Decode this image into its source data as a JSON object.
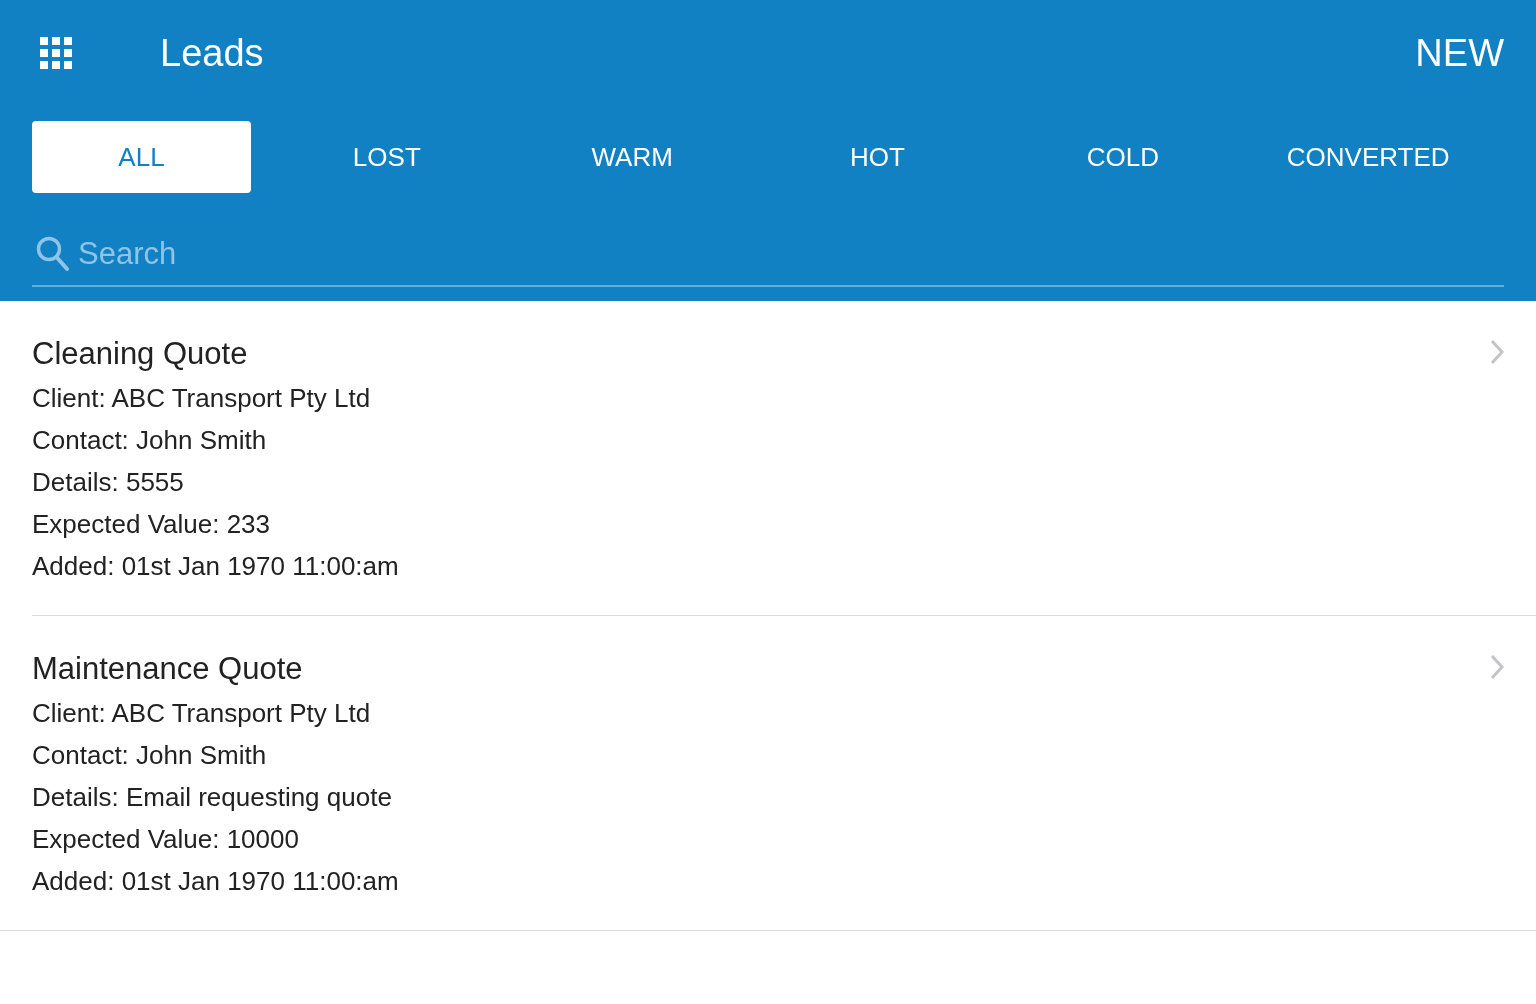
{
  "header": {
    "title": "Leads",
    "action": "NEW"
  },
  "tabs": [
    {
      "label": "ALL",
      "selected": true
    },
    {
      "label": "LOST",
      "selected": false
    },
    {
      "label": "WARM",
      "selected": false
    },
    {
      "label": "HOT",
      "selected": false
    },
    {
      "label": "COLD",
      "selected": false
    },
    {
      "label": "CONVERTED",
      "selected": false
    }
  ],
  "search": {
    "placeholder": "Search"
  },
  "leads": [
    {
      "title": "Cleaning Quote",
      "lines": [
        "Client: ABC Transport Pty Ltd",
        "Contact: John Smith",
        "Details: 5555",
        "Expected Value: 233",
        "Added: 01st Jan 1970 11:00:am"
      ]
    },
    {
      "title": "Maintenance Quote",
      "lines": [
        "Client: ABC Transport Pty Ltd",
        "Contact: John Smith",
        "Details: Email requesting quote",
        "Expected Value: 10000",
        "Added: 01st Jan 1970 11:00:am"
      ]
    }
  ]
}
